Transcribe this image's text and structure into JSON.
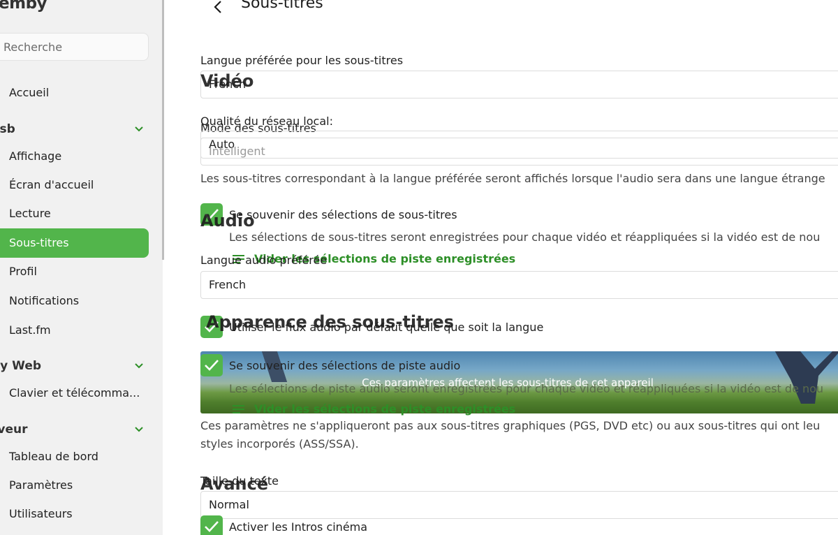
{
  "sidebar": {
    "logo": "emby",
    "search_placeholder": "Recherche",
    "home": "Accueil",
    "sections": [
      {
        "title": "esb"
      },
      {
        "title": "by Web"
      },
      {
        "title": "rveur"
      }
    ],
    "user_items": [
      "Affichage",
      "Écran d'accueil",
      "Lecture",
      "Sous-titres",
      "Profil",
      "Notifications",
      "Last.fm"
    ],
    "web_items": [
      "Clavier et télécomma..."
    ],
    "server_items": [
      "Tableau de bord",
      "Paramètres",
      "Utilisateurs"
    ]
  },
  "page": {
    "title": "Sous-titres",
    "subtitle_lang_label": "Langue préférée pour les sous-titres",
    "subtitle_lang_value": "French",
    "video_heading": "Vidéo",
    "network_quality_label": "Qualité du réseau local:",
    "subtitle_mode_label": "Mode des sous-titres",
    "network_quality_value": "Auto",
    "subtitle_mode_value": "Intelligent",
    "subtitle_mode_desc": "Les sous-titres correspondant à la langue préférée seront affichés lorsque l'audio sera dans une langue étrange",
    "remember_subs_label": "Se souvenir des sélections de sous-titres",
    "audio_heading": "Audio",
    "remember_subs_desc": "Les sélections de sous-titres seront enregistrées pour chaque vidéo et réappliquées si la vidéo est de nou",
    "clear_track_link": "Vider les sélections de piste enregistrées",
    "audio_lang_label": "Langue audio préférée",
    "audio_lang_value": "French",
    "appearance_heading": "Apparence des sous-titres",
    "default_audio_label": "Utiliser le flux audio par défaut quelle que soit la langue",
    "remember_audio_label": "Se souvenir des sélections de piste audio",
    "banner_text": "Ces paramètres affectent les sous-titres de cet appareil",
    "remember_audio_desc": "Les sélections de piste audio seront enregistrées pour chaque vidéo et réappliquées si la vidéo est de nou",
    "clear_track_link_2": "Vider les sélections de piste enregistrées",
    "graphic_note_line1": "Ces paramètres ne s'appliqueront pas aux sous-titres graphiques (PGS, DVD etc) ou aux sous-titres qui ont leu",
    "graphic_note_line2": "styles incorporés (ASS/SSA).",
    "text_size_label": "Taille du texte",
    "advanced_heading": "Avancé",
    "text_size_value": "Normal",
    "cinema_intros_label": "Activer les Intros cinéma"
  },
  "colors": {
    "accent": "#52b54b",
    "link": "#2d8f27"
  }
}
